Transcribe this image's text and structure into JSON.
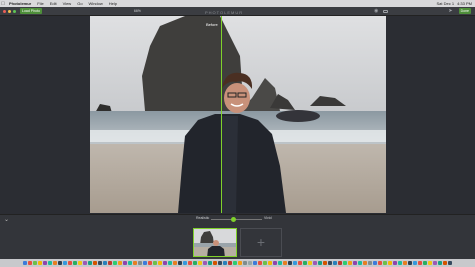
{
  "menubar": {
    "app_name": "Photolemur",
    "items": [
      "File",
      "Edit",
      "View",
      "Go",
      "Window",
      "Help"
    ],
    "status": [
      "Sat Dec 1",
      "4:33 PM"
    ]
  },
  "toolbar": {
    "load_button": "Load Photo",
    "zoom_label": "66%",
    "brand": "PHOTOLEMUR",
    "done_button": "Done"
  },
  "canvas": {
    "split_label": "Before"
  },
  "bottom": {
    "slider_left_label": "Realistic",
    "slider_right_label": "Vivid",
    "slider_value": 0.45,
    "add_symbol": "+"
  },
  "dock": {
    "colors": [
      "#3d7bd9",
      "#e94e3c",
      "#6bbf4a",
      "#f4b400",
      "#8e44ad",
      "#1abc9c",
      "#e67e22",
      "#2c3e50",
      "#3498db",
      "#e74c3c",
      "#27ae60",
      "#f1c40f",
      "#9b59b6",
      "#16a085",
      "#d35400",
      "#34495e",
      "#2980b9",
      "#c0392b",
      "#2ecc71",
      "#f39c12",
      "#8e44ad",
      "#1abc9c",
      "#e67e22",
      "#7f8c8d",
      "#3d7bd9",
      "#e94e3c",
      "#6bbf4a",
      "#f4b400",
      "#8e44ad",
      "#1abc9c",
      "#e67e22",
      "#2c3e50",
      "#3498db",
      "#e74c3c",
      "#27ae60",
      "#f1c40f",
      "#9b59b6",
      "#16a085",
      "#d35400",
      "#34495e",
      "#2980b9",
      "#c0392b",
      "#2ecc71",
      "#f39c12",
      "#7f8c8d",
      "#95a5a6",
      "#3d7bd9",
      "#e94e3c",
      "#6bbf4a",
      "#f4b400",
      "#8e44ad",
      "#1abc9c",
      "#e67e22",
      "#2c3e50",
      "#3498db",
      "#e74c3c",
      "#27ae60",
      "#f1c40f",
      "#9b59b6",
      "#16a085",
      "#d35400",
      "#34495e",
      "#2980b9",
      "#c0392b",
      "#2ecc71",
      "#f39c12",
      "#8e44ad",
      "#1abc9c",
      "#e67e22",
      "#7f8c8d",
      "#3d7bd9",
      "#e94e3c",
      "#6bbf4a",
      "#f4b400",
      "#8e44ad",
      "#1abc9c",
      "#e67e22",
      "#2c3e50",
      "#3498db",
      "#e74c3c",
      "#27ae60",
      "#f1c40f",
      "#9b59b6",
      "#16a085",
      "#d35400",
      "#34495e"
    ]
  },
  "icons": [
    "apple-icon",
    "eye-icon",
    "compare-icon",
    "share-icon",
    "chevron-down-icon",
    "add-icon"
  ],
  "accent_color": "#7fd12b"
}
